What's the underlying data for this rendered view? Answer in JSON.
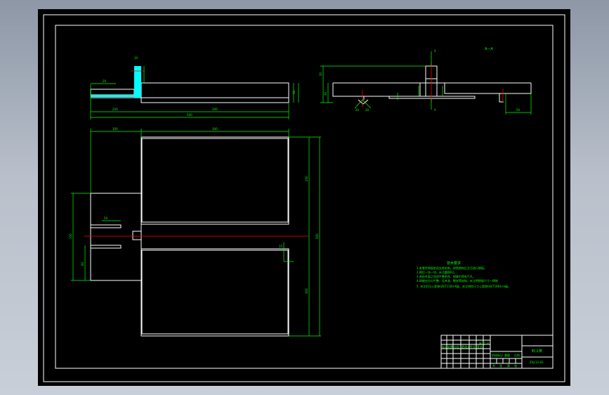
{
  "drawing": {
    "colors": {
      "paper": "#000000",
      "border": "#ffffff",
      "geometry": "#ffffff",
      "dimension": "#00ff00",
      "centerline": "#ff0000",
      "highlight": "#00ffff"
    },
    "section_label": "A—A",
    "section_marks": [
      "A",
      "A"
    ],
    "dimensions": {
      "front_view": [
        "10",
        "200",
        "20",
        "30",
        "250",
        "300",
        "500"
      ],
      "plan_view": [
        "100",
        "300",
        "250",
        "300",
        "500",
        "150",
        "60",
        "50",
        "50",
        "15"
      ],
      "section_view": [
        "20",
        "30",
        "50",
        "20",
        "20",
        "60"
      ]
    },
    "notes_title": "技术要求",
    "notes": [
      "1.各零件焊接前须去除毛刺、锐角倒钝后方可进行焊接。",
      "2.焊后一块一块、未注圆角R2。",
      "3.各结合面之间须平整密合，焊缝不得有气孔。",
      "4.焊缝应均匀平整，无夹渣、裂纹等缺陷，未注明焊接尺寸一律按",
      "5. 未注形位公差按GB/T1184-K级，未注线性尺寸公差按GB/T1804-m级。"
    ]
  },
  "title_block": {
    "drawing_name": "料斗架",
    "drawing_number": "ZXJ-12-03",
    "cells_left": [
      "标记",
      "处数",
      "分区",
      "更改文件号",
      "签名",
      "年.月.日"
    ],
    "stage_labels": [
      "阶段标记",
      "重量",
      "比例"
    ],
    "sheet_labels": [
      "共",
      "张",
      "第",
      "张"
    ]
  }
}
